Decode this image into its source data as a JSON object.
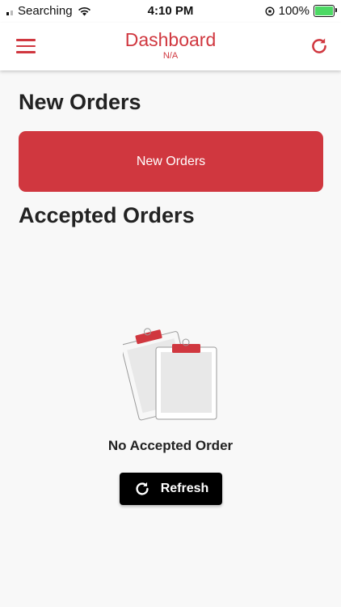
{
  "status_bar": {
    "carrier": "Searching",
    "time": "4:10 PM",
    "battery": "100%"
  },
  "app_bar": {
    "title": "Dashboard",
    "subtitle": "N/A"
  },
  "new_orders": {
    "heading": "New Orders",
    "button_label": "New Orders"
  },
  "accepted_orders": {
    "heading": "Accepted Orders",
    "empty_text": "No Accepted Order",
    "refresh_label": "Refresh"
  },
  "colors": {
    "accent": "#d0373f",
    "background": "#f8f8f8",
    "refresh_button": "#000000"
  },
  "icons": {
    "menu": "hamburger-menu-icon",
    "refresh": "refresh-icon",
    "empty": "clipboard-illustration"
  }
}
